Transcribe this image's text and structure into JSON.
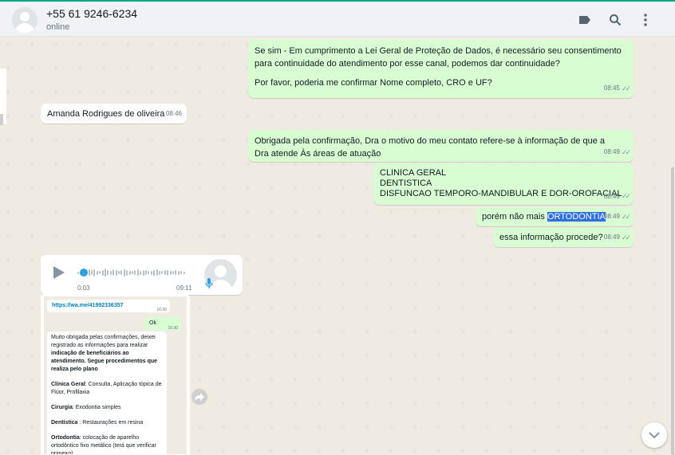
{
  "header": {
    "contact_name": "+55 61 9246-6234",
    "status": "online",
    "icons": [
      "label-icon",
      "search-icon",
      "menu-icon"
    ]
  },
  "messages": {
    "m1": {
      "text": "Se sim - Em cumprimento a Lei Geral de Proteção de Dados, é necessário seu consentimento para continuidade do atendimento por esse canal, podemos dar continuidade?",
      "text2": "Por favor, poderia me confirmar Nome completo, CRO e UF?",
      "time": "08:45"
    },
    "m2": {
      "text": "Amanda Rodrigues  de oliveira",
      "time": "08:46"
    },
    "m3": {
      "text": "Obrigada pela confirmação, Dra o motivo do meu contato refere-se à informação de que a Dra atende Às áreas de atuação",
      "time": "08:49"
    },
    "m4": {
      "line1": "CLINICA GERAL",
      "line2": "DENTISTICA",
      "line3": "DISFUNCAO TEMPORO-MANDIBULAR E DOR-OROFACIAL",
      "time": "08:49"
    },
    "m5": {
      "text": "porém não mais ",
      "highlight": "ORTODONTIA",
      "time": "08:49"
    },
    "m6": {
      "text": "essa informação procede?",
      "time": "08:49"
    },
    "audio": {
      "elapsed": "0:03",
      "time": "09:11",
      "progress": 0.05
    },
    "image": {
      "link": "https://wa.me/41992336357",
      "link_time": "16:30",
      "ok": "Ok",
      "ok_time": "16:30",
      "intro_normal": "Muito obrigada pelas confirmações, deixei registrado as informações para realizar ",
      "intro_bold": "indicação de beneficiários ao atendimento. Segue procedimentos que realiza pelo plano",
      "p1_label": "Clínica Geral",
      "p1_text": ": Consulta, Aplicação tópica de Flúor, Profilaxia",
      "p2_label": "Cirurgia",
      "p2_text": ": Exodontia simples",
      "p3_label": "Dentística",
      "p3_text": "  : Restaurações em resina",
      "p4_label": "Ortodontia",
      "p4_text": ": colocação de aparelho ortodôntico fixo metálico (terá que verificar primeiro)"
    }
  }
}
